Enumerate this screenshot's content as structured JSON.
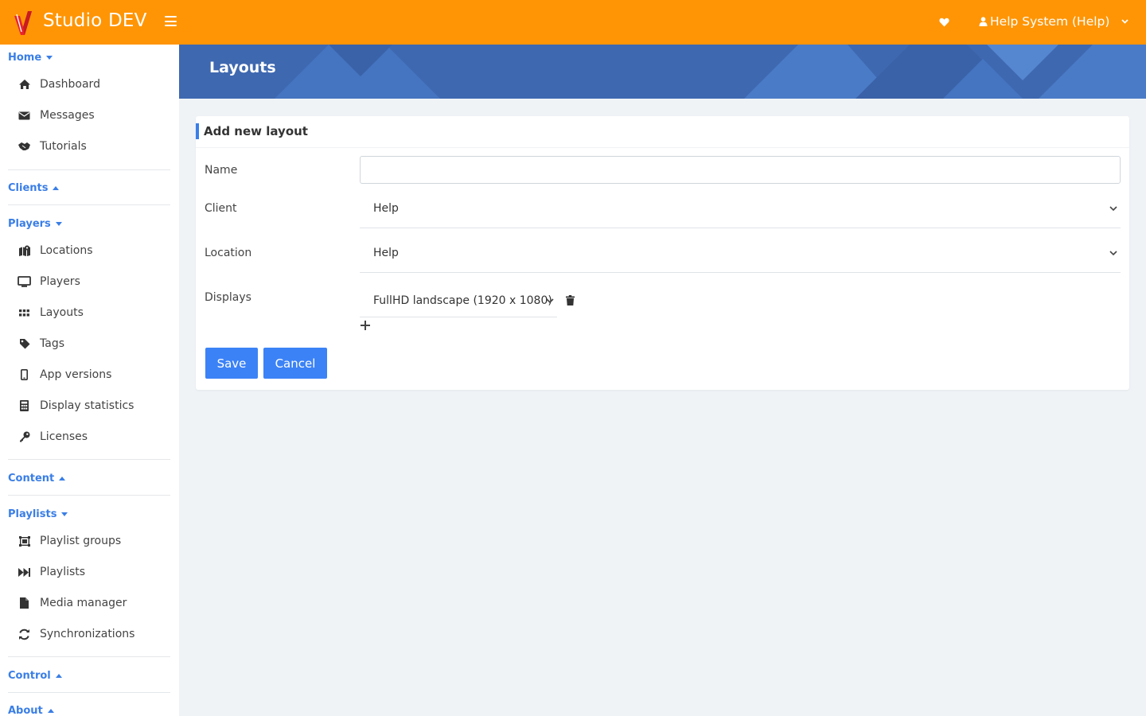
{
  "app": {
    "title": "Studio DEV",
    "user_label": "Help System (Help)",
    "brand_color": "#ff9505",
    "accent_color": "#3a7ee6"
  },
  "sidebar": {
    "sections": [
      {
        "label": "Home",
        "expanded": true,
        "items": [
          "Dashboard",
          "Messages",
          "Tutorials"
        ]
      },
      {
        "label": "Clients",
        "expanded": false,
        "items": []
      },
      {
        "label": "Players",
        "expanded": true,
        "items": [
          "Locations",
          "Players",
          "Layouts",
          "Tags",
          "App versions",
          "Display statistics",
          "Licenses"
        ]
      },
      {
        "label": "Content",
        "expanded": false,
        "items": []
      },
      {
        "label": "Playlists",
        "expanded": true,
        "items": [
          "Playlist groups",
          "Playlists",
          "Media manager",
          "Synchronizations"
        ]
      },
      {
        "label": "Control",
        "expanded": false,
        "items": []
      },
      {
        "label": "About",
        "expanded": false,
        "items": []
      }
    ]
  },
  "page": {
    "title": "Layouts"
  },
  "form": {
    "title": "Add new layout",
    "name_label": "Name",
    "name_value": "",
    "client_label": "Client",
    "client_value": "Help",
    "location_label": "Location",
    "location_value": "Help",
    "displays_label": "Displays",
    "display_value": "FullHD landscape (1920 x 1080)",
    "save_label": "Save",
    "cancel_label": "Cancel"
  },
  "icons": {
    "topbar": [
      "logo-icon",
      "menu-icon",
      "heart-icon",
      "user-icon",
      "chevron-down-icon"
    ],
    "nav": [
      "home-icon",
      "envelope-icon",
      "handshake-icon",
      "map-icon",
      "monitor-icon",
      "grid-icon",
      "tag-icon",
      "mobile-icon",
      "calculator-icon",
      "key-icon",
      "group-icon",
      "fast-forward-icon",
      "file-icon",
      "sync-icon"
    ]
  }
}
